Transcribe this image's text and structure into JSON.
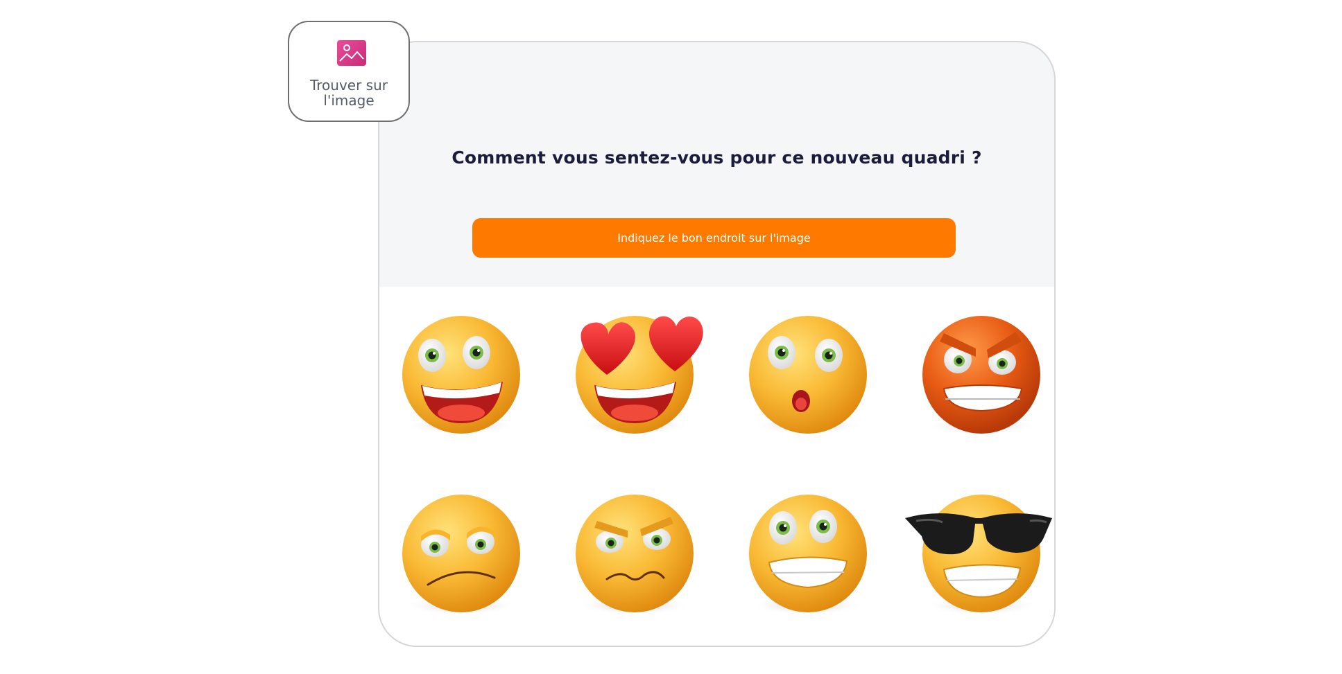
{
  "badge": {
    "label": "Trouver sur\nl'image",
    "icon": "image-icon",
    "icon_color": "#d93d8c"
  },
  "question": {
    "text": "Comment vous sentez-vous pour ce nouveau quadri ?"
  },
  "instruction": {
    "text": "Indiquez le bon endroit sur l'image",
    "color": "#fe7900"
  },
  "emojis": [
    {
      "name": "laughing-face-icon"
    },
    {
      "name": "heart-eyes-face-icon"
    },
    {
      "name": "surprised-face-icon"
    },
    {
      "name": "angry-face-icon"
    },
    {
      "name": "sad-face-icon"
    },
    {
      "name": "annoyed-face-icon"
    },
    {
      "name": "grimacing-face-icon"
    },
    {
      "name": "sunglasses-face-icon"
    }
  ],
  "colors": {
    "accent": "#fe7900",
    "title": "#1a1c3b",
    "card_background": "#f5f6f8",
    "emoji_yellow": "#f7b733",
    "emoji_orange": "#e05a14"
  }
}
